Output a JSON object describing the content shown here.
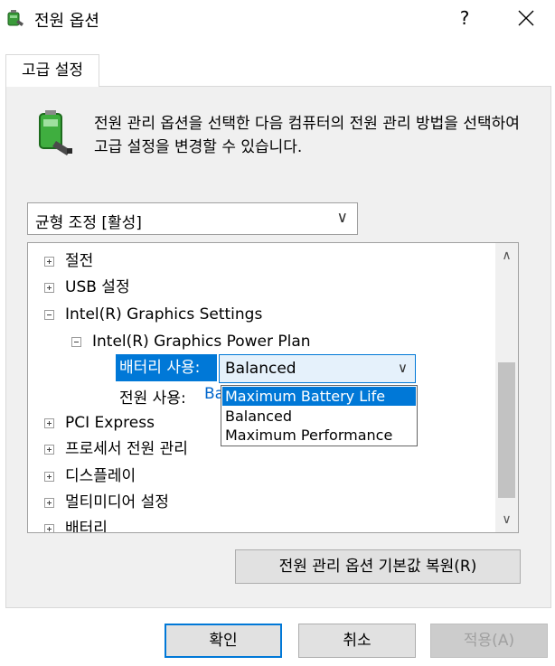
{
  "window": {
    "title": "전원 옵션",
    "help_label": "?",
    "close_label": "✕"
  },
  "tab": {
    "label": "고급 설정"
  },
  "description": "전원 관리 옵션을 선택한 다음 컴퓨터의 전원 관리 방법을 선택하여 고급 설정을 변경할 수 있습니다.",
  "plan_select": {
    "value": "균형 조정 [활성]",
    "chevron": "∨"
  },
  "tree": {
    "items": [
      {
        "label": "절전",
        "expander": "plus"
      },
      {
        "label": "USB 설정",
        "expander": "plus"
      },
      {
        "label": "Intel(R) Graphics Settings",
        "expander": "minus"
      },
      {
        "label": "Intel(R) Graphics Power Plan",
        "expander": "minus"
      },
      {
        "label": "PCI Express",
        "expander": "plus"
      },
      {
        "label": "프로세서 전원 관리",
        "expander": "plus"
      },
      {
        "label": "디스플레이",
        "expander": "plus"
      },
      {
        "label": "멀티미디어 설정",
        "expander": "plus"
      },
      {
        "label": "배터리",
        "expander": "plus"
      }
    ],
    "battery_setting": {
      "label": "배터리 사용:",
      "value": "Balanced",
      "chevron": "∨"
    },
    "ac_setting": {
      "label": "전원 사용:",
      "value": "Ba"
    },
    "dropdown_options": [
      {
        "label": "Maximum Battery Life",
        "selected": true
      },
      {
        "label": "Balanced",
        "selected": false
      },
      {
        "label": "Maximum Performance",
        "selected": false
      }
    ],
    "scroll_up": "∧",
    "scroll_down": "∨"
  },
  "buttons": {
    "restore": "전원 관리 옵션 기본값 복원(R)",
    "ok": "확인",
    "cancel": "취소",
    "apply": "적용(A)"
  },
  "colors": {
    "accent": "#0078d7",
    "link": "#0066cc"
  }
}
